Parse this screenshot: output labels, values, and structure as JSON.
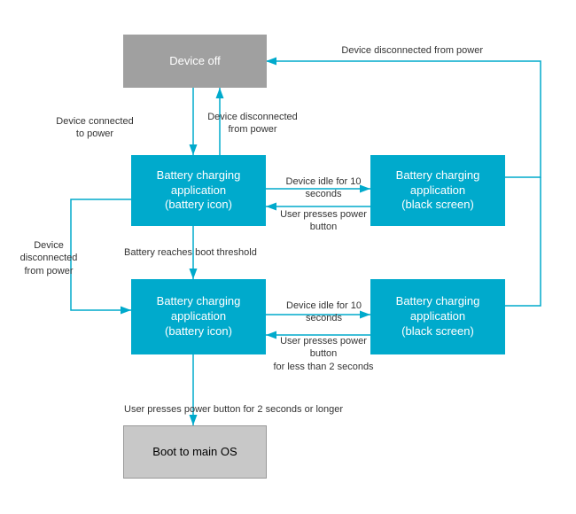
{
  "boxes": {
    "device_off": {
      "label": "Device off"
    },
    "battery_charging_top_left": {
      "label": "Battery charging\napplication\n(battery icon)"
    },
    "battery_charging_top_right": {
      "label": "Battery charging\napplication\n(black screen)"
    },
    "battery_charging_bot_left": {
      "label": "Battery charging\napplication\n(battery icon)"
    },
    "battery_charging_bot_right": {
      "label": "Battery charging\napplication\n(black screen)"
    },
    "boot_main_os": {
      "label": "Boot to main OS"
    }
  },
  "labels": {
    "device_connected": "Device connected\nto power",
    "device_disconnected_top": "Device disconnected\nfrom power",
    "device_disconnected_from_power_right": "Device disconnected from power",
    "idle_10s_top": "Device idle for 10 seconds",
    "user_presses_power_top": "User presses power button",
    "device_disconnected_left": "Device disconnected\nfrom power",
    "battery_reaches": "Battery reaches boot threshold",
    "idle_10s_bot": "Device idle for 10 seconds",
    "user_presses_less": "User presses power button\nfor less than 2 seconds",
    "user_presses_longer": "User presses power button for 2 seconds or longer"
  },
  "colors": {
    "arrow": "#00aacc",
    "box_blue": "#00aacc",
    "box_gray": "#a0a0a0",
    "box_light_gray": "#c0c0c0"
  }
}
